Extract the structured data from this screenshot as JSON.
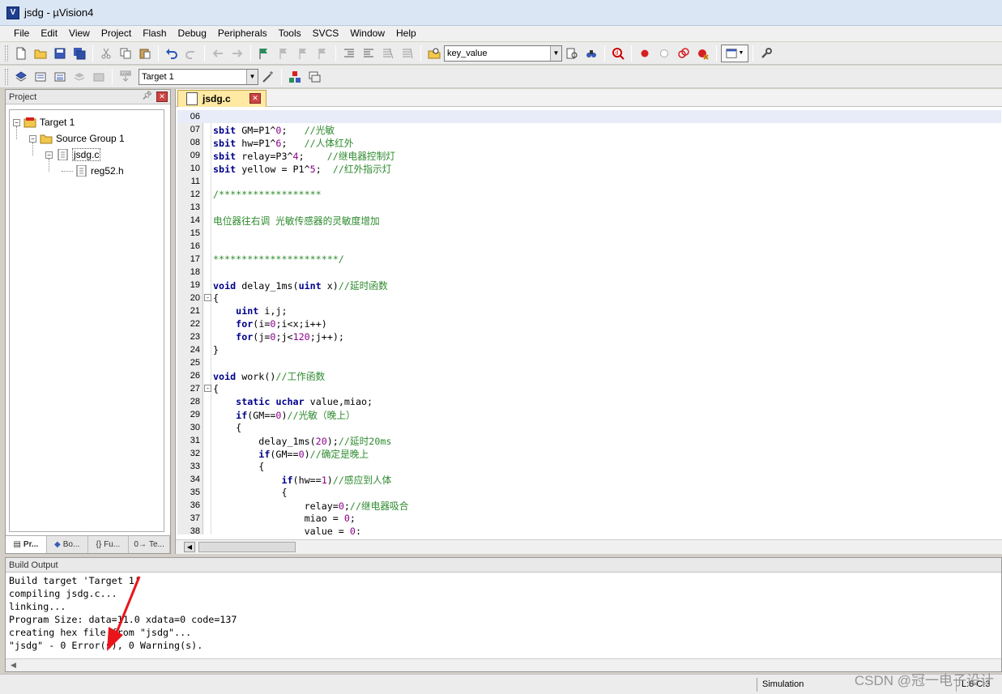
{
  "window": {
    "title": "jsdg  - µVision4",
    "icon": "uvision-icon"
  },
  "menu": [
    "File",
    "Edit",
    "View",
    "Project",
    "Flash",
    "Debug",
    "Peripherals",
    "Tools",
    "SVCS",
    "Window",
    "Help"
  ],
  "toolbar": {
    "find_combo": "key_value",
    "target_combo": "Target 1"
  },
  "project_panel": {
    "title": "Project",
    "pin": "p",
    "tree": {
      "target": "Target 1",
      "group": "Source Group 1",
      "file": "jsdg.c",
      "include": "reg52.h"
    },
    "tabs": [
      {
        "icon": "project-tab-icon",
        "label": "Pr..."
      },
      {
        "icon": "books-tab-icon",
        "label": "Bo..."
      },
      {
        "icon": "{}",
        "label": "Fu..."
      },
      {
        "icon": "0→",
        "label": "Te..."
      }
    ]
  },
  "editor": {
    "tab_label": "jsdg.c",
    "lines": [
      {
        "n": "06",
        "code": "",
        "current": true
      },
      {
        "n": "07",
        "code": "sbit GM=P1^0;   //光敏"
      },
      {
        "n": "08",
        "code": "sbit hw=P1^6;   //人体红外"
      },
      {
        "n": "09",
        "code": "sbit relay=P3^4;    //继电器控制灯"
      },
      {
        "n": "10",
        "code": "sbit yellow = P1^5;  //红外指示灯"
      },
      {
        "n": "11",
        "code": ""
      },
      {
        "n": "12",
        "code": "/******************"
      },
      {
        "n": "13",
        "code": ""
      },
      {
        "n": "14",
        "code": "电位器往右调 光敏传感器的灵敏度增加"
      },
      {
        "n": "15",
        "code": ""
      },
      {
        "n": "16",
        "code": ""
      },
      {
        "n": "17",
        "code": "**********************/"
      },
      {
        "n": "18",
        "code": ""
      },
      {
        "n": "19",
        "code": "void delay_1ms(uint x)//延时函数"
      },
      {
        "n": "20",
        "code": "{",
        "fold": "-"
      },
      {
        "n": "21",
        "code": "    uint i,j;"
      },
      {
        "n": "22",
        "code": "    for(i=0;i<x;i++)"
      },
      {
        "n": "23",
        "code": "    for(j=0;j<120;j++);"
      },
      {
        "n": "24",
        "code": "}"
      },
      {
        "n": "25",
        "code": ""
      },
      {
        "n": "26",
        "code": "void work()//工作函数"
      },
      {
        "n": "27",
        "code": "{",
        "fold": "-"
      },
      {
        "n": "28",
        "code": "    static uchar value,miao;"
      },
      {
        "n": "29",
        "code": "    if(GM==0)//光敏（晚上）"
      },
      {
        "n": "30",
        "code": "    {"
      },
      {
        "n": "31",
        "code": "        delay_1ms(20);//延时20ms"
      },
      {
        "n": "32",
        "code": "        if(GM==0)//确定是晚上"
      },
      {
        "n": "33",
        "code": "        {"
      },
      {
        "n": "34",
        "code": "            if(hw==1)//感应到人体"
      },
      {
        "n": "35",
        "code": "            {"
      },
      {
        "n": "36",
        "code": "                relay=0;//继电器吸合"
      },
      {
        "n": "37",
        "code": "                miao = 0;"
      },
      {
        "n": "38",
        "code": "                value = 0;"
      }
    ]
  },
  "build_output": {
    "title": "Build Output",
    "lines": [
      "Build target 'Target 1'",
      "compiling jsdg.c...",
      "linking...",
      "Program Size: data=11.0 xdata=0 code=137",
      "creating hex file from \"jsdg\"...",
      "\"jsdg\" - 0 Error(s), 0 Warning(s)."
    ]
  },
  "status": {
    "mode": "Simulation",
    "position": "L:6 C:3"
  },
  "watermark": "CSDN @冠一电子设计",
  "colors": {
    "comment": "#2e8b2e",
    "number": "#8b008b",
    "keyword": "#00008b",
    "arrow": "#e8161b"
  }
}
